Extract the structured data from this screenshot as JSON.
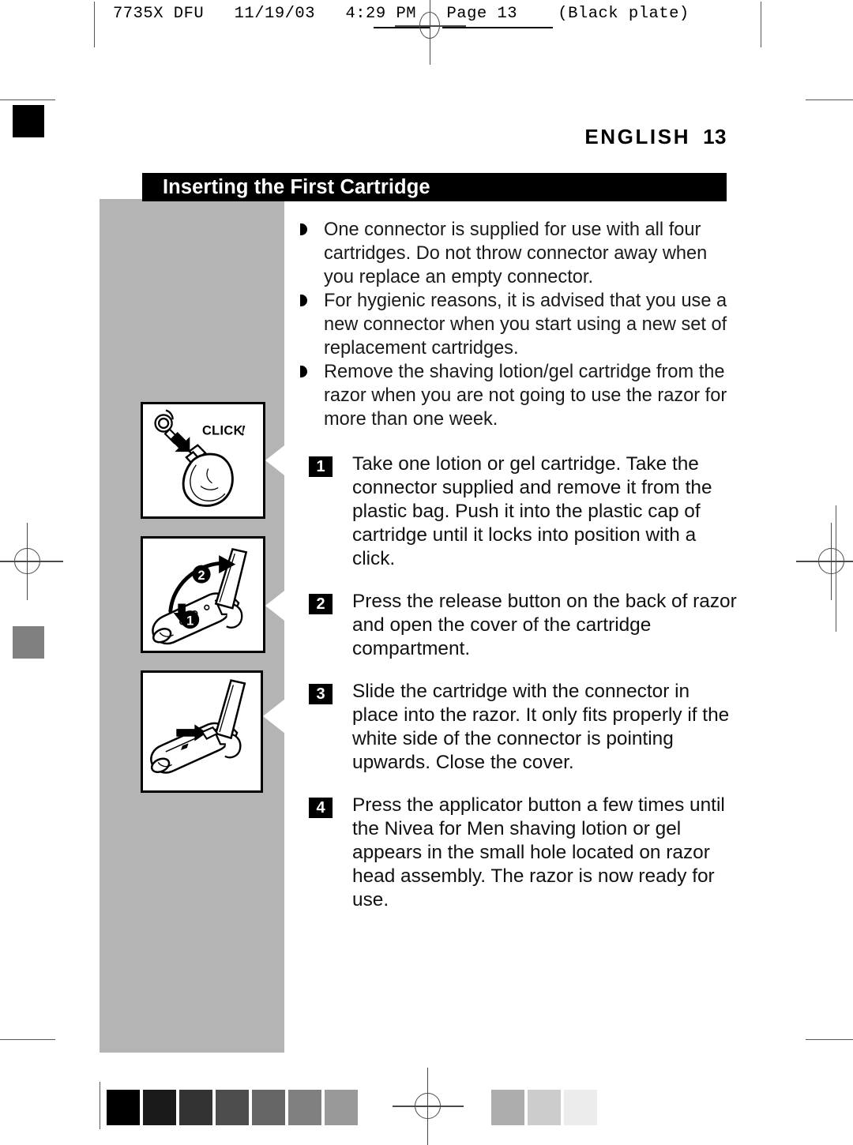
{
  "print_marks": {
    "header_line": "7735X DFU   11/19/03   4:29 PM   Page 13    (Black plate)",
    "registration_icon": "registration-crosshair-icon"
  },
  "header": {
    "language": "ENGLISH",
    "page_number": "13"
  },
  "section": {
    "title": "Inserting the First Cartridge"
  },
  "bullets": [
    {
      "text": "One connector is supplied for use with all four cartridges.  Do not throw connector away when you replace an empty connector."
    },
    {
      "text": "For hygienic reasons, it is advised that you use a new connector when you start using a new set of replacement cartridges."
    },
    {
      "text": "Remove the shaving lotion/gel cartridge from the razor when you are not going to use the razor for more than one week."
    }
  ],
  "steps": [
    {
      "number": "1",
      "text": "Take one lotion or gel cartridge. Take the connector supplied and remove it from the plastic bag. Push it into the plastic cap of cartridge until it locks into position with a click."
    },
    {
      "number": "2",
      "text": "Press the release button on the back of razor and open the cover of the cartridge compartment."
    },
    {
      "number": "3",
      "text": "Slide the cartridge with the connector in place into the razor. It only fits properly if the white side of the connector is pointing upwards. Close the cover."
    },
    {
      "number": "4",
      "text": "Press the applicator button a few times until the Nivea for Men shaving lotion or gel appears in the small hole located on razor head assembly. The razor is now ready for use."
    }
  ],
  "illustrations": [
    {
      "name": "cartridge-connector-click",
      "caption": "CLICK!",
      "callouts": []
    },
    {
      "name": "razor-open-cover",
      "caption": "",
      "callouts": [
        "1",
        "2"
      ]
    },
    {
      "name": "razor-slide-cartridge",
      "caption": "",
      "callouts": []
    }
  ],
  "color_strip": {
    "dark_swatches": [
      "#000000",
      "#1a1a1a",
      "#333333",
      "#4d4d4d",
      "#666666",
      "#808080",
      "#999999"
    ],
    "light_swatches": [
      "#adadad",
      "#cccccc",
      "#ececec"
    ]
  },
  "margin_swatches": {
    "top_left": "#000000",
    "mid_left": "#808080",
    "panel_gray": "#b4b4b4"
  }
}
